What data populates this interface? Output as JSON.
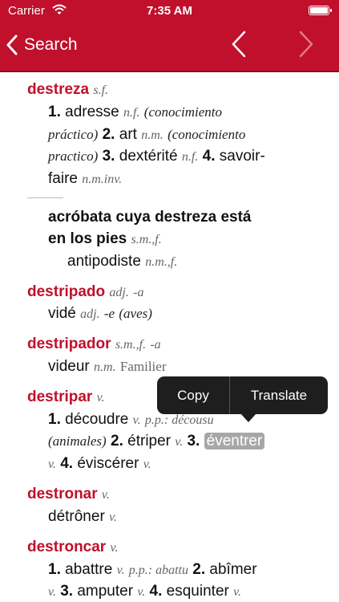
{
  "status": {
    "carrier": "Carrier",
    "time": "7:35 AM"
  },
  "nav": {
    "back_label": "Search"
  },
  "colors": {
    "brand": "#c0102b",
    "highlight": "#a7a7a7",
    "popup": "#1e1e1e"
  },
  "entries": {
    "destreza": {
      "headword": "destreza",
      "gram": "s.f.",
      "n1": "1.",
      "t1": "adresse",
      "g1": "n.f.",
      "p1a": "(",
      "i1": "conocimiento",
      "i1b": "práctico",
      "p1b": ")",
      "n2": "2.",
      "t2": "art",
      "g2": "n.m.",
      "i2open": "(",
      "i2": "conocimiento",
      "i2b": "practico",
      "p2b": ")",
      "n3": "3.",
      "t3": "dextérité",
      "g3": "n.f.",
      "n4": "4.",
      "t4a": "savoir-",
      "t4b": "faire",
      "g4": "n.m.inv."
    },
    "phrase": {
      "line1": "acróbata cuya destreza está",
      "line2": "en los pies",
      "gram": "s.m.,f.",
      "translation": "antipodiste",
      "tgram": "n.m.,f."
    },
    "destripado": {
      "headword": "destripado",
      "gram": "adj.",
      "suffix": "-a",
      "translation": "vidé",
      "tgram": "adj.",
      "tsuffix": "-e",
      "note": "(aves)"
    },
    "destripador": {
      "headword": "destripador",
      "gram": "s.m.,f.",
      "suffix": "-a",
      "translation": "videur",
      "tgram": "n.m.",
      "register": "Familier"
    },
    "destripar": {
      "headword": "destripar",
      "gram": "v.",
      "n1": "1.",
      "t1": "découdre",
      "g1": "v.",
      "pp": "p.p.: décousu",
      "note": "(animales)",
      "n2": "2.",
      "t2": "étriper",
      "g2": "v.",
      "n3": "3.",
      "t3": "éventrer",
      "g3": "v.",
      "n4": "4.",
      "t4": "éviscérer",
      "g4": "v."
    },
    "destronar": {
      "headword": "destronar",
      "gram": "v.",
      "translation": "détrôner",
      "tgram": "v."
    },
    "destroncar": {
      "headword": "destroncar",
      "gram": "v.",
      "n1": "1.",
      "t1": "abattre",
      "g1": "v.",
      "pp": "p.p.: abattu",
      "n2": "2.",
      "t2": "abîmer",
      "g2": "v.",
      "n3": "3.",
      "t3": "amputer",
      "g3": "v.",
      "n4": "4.",
      "t4": "esquinter",
      "g4": "v."
    }
  },
  "popup": {
    "copy": "Copy",
    "translate": "Translate"
  }
}
